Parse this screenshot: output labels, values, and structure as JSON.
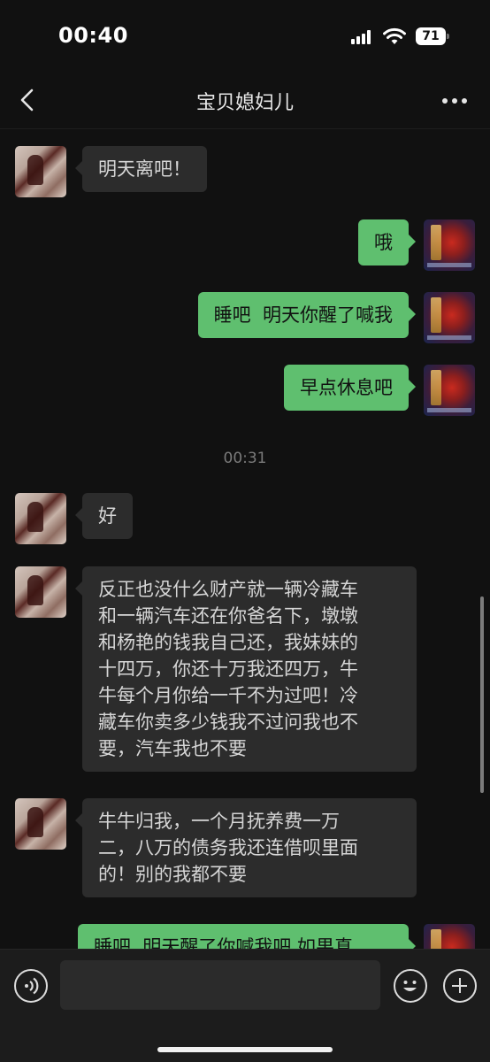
{
  "status_bar": {
    "time": "00:40",
    "battery": "71",
    "icons": [
      "signal-icon",
      "wifi-icon",
      "battery-icon"
    ]
  },
  "nav": {
    "title": "宝贝媳妇儿",
    "back_icon": "chevron-left-icon",
    "more_icon": "more-dots-icon"
  },
  "messages": [
    {
      "sender": "other",
      "text": "明天离吧！"
    },
    {
      "sender": "me",
      "text": "哦"
    },
    {
      "sender": "me",
      "text": "睡吧  明天你醒了喊我"
    },
    {
      "sender": "me",
      "text": "早点休息吧"
    },
    {
      "type": "time",
      "text": "00:31"
    },
    {
      "sender": "other",
      "text": "好"
    },
    {
      "sender": "other",
      "text": "反正也没什么财产就一辆冷藏车\n和一辆汽车还在你爸名下，墩墩\n和杨艳的钱我自己还，我妹妹的\n十四万，你还十万我还四万，牛\n牛每个月你给一千不为过吧！冷\n藏车你卖多少钱我不过问我也不\n要，汽车我也不要"
    },
    {
      "sender": "other",
      "text": "牛牛归我，一个月抚养费一万\n二，八万的债务我还连借呗里面\n的！别的我都不要"
    },
    {
      "sender": "me",
      "text": "睡吧  明天醒了你喊我吧 如果真"
    }
  ],
  "input": {
    "value": "",
    "voice_icon": "voice-icon",
    "emoji_icon": "emoji-icon",
    "add_icon": "plus-icon"
  },
  "colors": {
    "background": "#111111",
    "bubble_other": "#2c2c2c",
    "bubble_me": "#5fbf6f"
  }
}
